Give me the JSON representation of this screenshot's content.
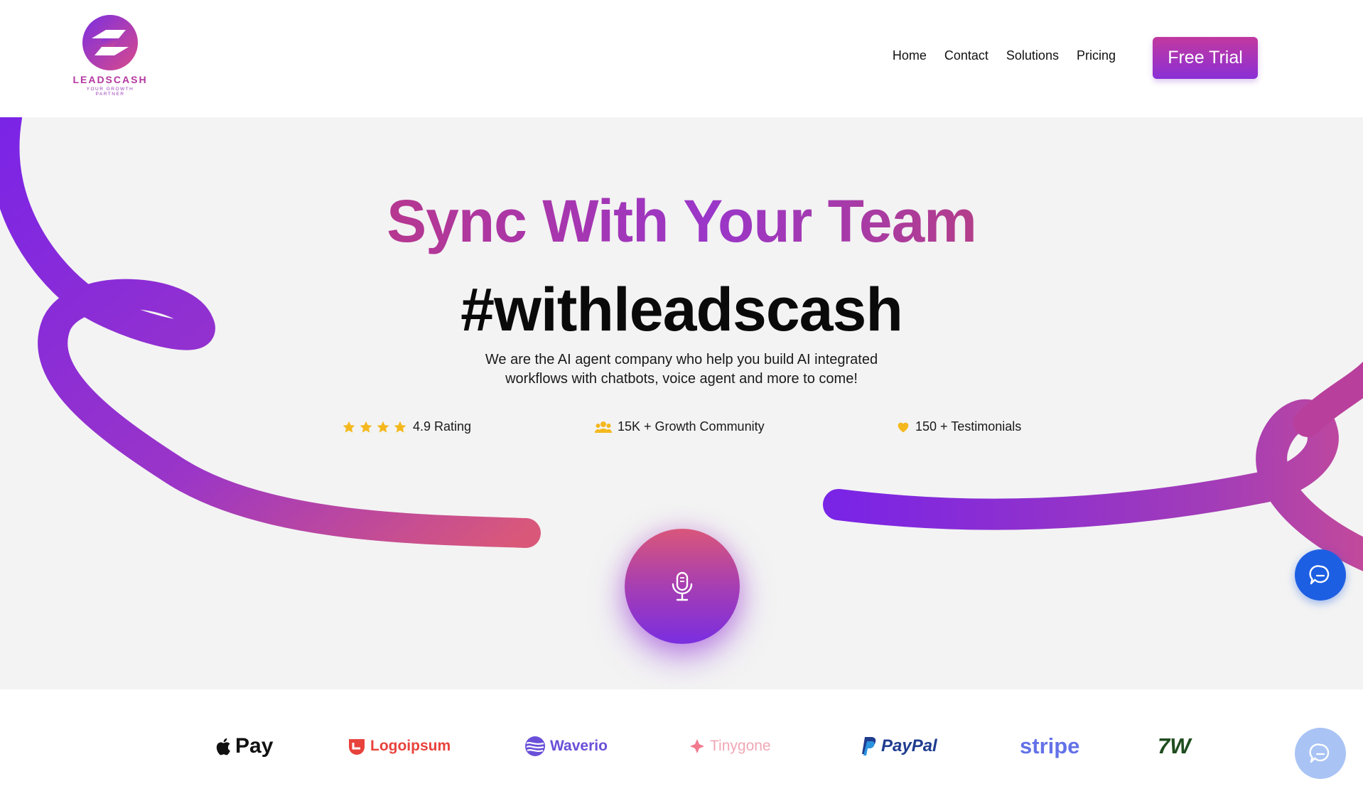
{
  "header": {
    "logo": {
      "name": "LEADSCASH",
      "tagline": "YOUR GROWTH PARTNER",
      "icon": "leadscash-logo-icon"
    },
    "nav": [
      {
        "label": "Home"
      },
      {
        "label": "Contact"
      },
      {
        "label": "Solutions"
      },
      {
        "label": "Pricing"
      }
    ],
    "cta_label": "Free Trial"
  },
  "hero": {
    "title": "Sync With Your Team",
    "hashtag": "#withleadscash",
    "description": "We are the AI agent company who help you build AI integrated workflows with chatbots, voice agent and more to come!",
    "stats": [
      {
        "icon": "star-icon",
        "label": "4.9 Rating",
        "stars": 4
      },
      {
        "icon": "users-icon",
        "label": "15K + Growth Community"
      },
      {
        "icon": "heart-icon",
        "label": "150 + Testimonials"
      }
    ],
    "mic_icon": "microphone-icon"
  },
  "partners": [
    {
      "label": "Pay",
      "icon": "apple-icon",
      "color": "#111111"
    },
    {
      "label": "Logoipsum",
      "icon": "logoipsum-icon",
      "color": "#e8423c"
    },
    {
      "label": "Waverio",
      "icon": "waverio-icon",
      "color": "#6a4fd8"
    },
    {
      "label": "Tinygone",
      "icon": "tinygone-icon",
      "color": "#f0a7b4"
    },
    {
      "label": "PayPal",
      "icon": "paypal-icon",
      "color": "#1f3c8f"
    },
    {
      "label": "stripe",
      "icon": "stripe-icon",
      "color": "#6372e8"
    },
    {
      "label": "7W",
      "icon": "wise-icon",
      "color": "#1f4d1f"
    }
  ],
  "chat": {
    "icon": "chat-icon"
  },
  "colors": {
    "brand_purple": "#8a2fd6",
    "brand_pink": "#c2399f",
    "chat_blue": "#1d5fe3",
    "star_yellow": "#f4b81e"
  }
}
